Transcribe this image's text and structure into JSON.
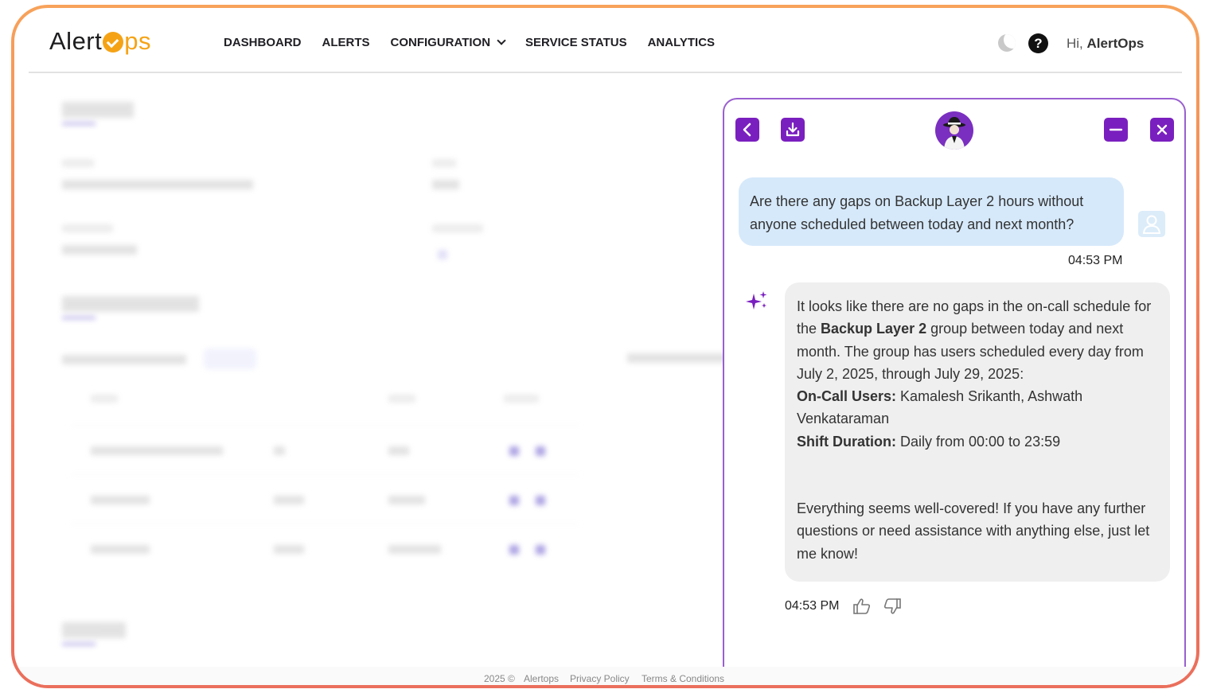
{
  "app": {
    "logo_prefix": "Alert",
    "logo_suffix": "ps",
    "accent_color": "#f5a315",
    "brand_purple": "#7a1fbf"
  },
  "nav": {
    "items": [
      "DASHBOARD",
      "ALERTS",
      "CONFIGURATION",
      "SERVICE STATUS",
      "ANALYTICS"
    ]
  },
  "header": {
    "greeting_prefix": "Hi, ",
    "user_name": "AlertOps",
    "help_label": "?"
  },
  "chat": {
    "user_message": "Are there any gaps on Backup Layer 2 hours without anyone scheduled between today and next month?",
    "user_time": "04:53 PM",
    "bot": {
      "p1_before": "It looks like there are no gaps in the on-call schedule for the ",
      "p1_bold": "Backup Layer 2",
      "p1_after": " group between today and next month. The group has users scheduled every day from July 2, 2025, through July 29, 2025:",
      "oncall_label": "On-Call Users:",
      "oncall_value": " Kamalesh Srikanth, Ashwath Venkataraman",
      "shift_label": "Shift Duration:",
      "shift_value": " Daily from 00:00 to 23:59",
      "closing": "Everything seems well-covered! If you have any further questions or need assistance with anything else, just let me know!"
    },
    "bot_time": "04:53 PM"
  },
  "footer": {
    "copyright": "2025 ©",
    "company": "Alertops",
    "privacy": "Privacy Policy",
    "terms": "Terms & Conditions"
  }
}
